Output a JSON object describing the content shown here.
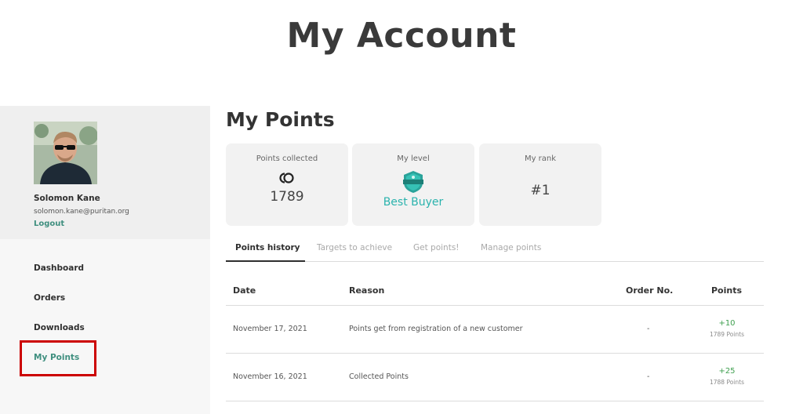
{
  "page": {
    "title": "My Account"
  },
  "profile": {
    "name": "Solomon Kane",
    "email": "solomon.kane@puritan.org",
    "logout_label": "Logout"
  },
  "nav": {
    "items": [
      {
        "label": "Dashboard"
      },
      {
        "label": "Orders"
      },
      {
        "label": "Downloads"
      },
      {
        "label": "My Points",
        "active": true
      }
    ]
  },
  "main": {
    "title": "My Points",
    "cards": {
      "points_collected": {
        "label": "Points collected",
        "value": "1789",
        "icon": "points-coin-icon"
      },
      "my_level": {
        "label": "My level",
        "value": "Best Buyer",
        "badge_icon": "best-buyer-badge-icon"
      },
      "my_rank": {
        "label": "My rank",
        "value": "#1"
      }
    },
    "tabs": [
      {
        "label": "Points history",
        "active": true
      },
      {
        "label": "Targets to achieve"
      },
      {
        "label": "Get points!"
      },
      {
        "label": "Manage points"
      }
    ],
    "table": {
      "headers": {
        "date": "Date",
        "reason": "Reason",
        "order_no": "Order No.",
        "points": "Points"
      },
      "rows": [
        {
          "date": "November 17, 2021",
          "reason": "Points get from registration of a new customer",
          "order_no": "-",
          "points": "+10",
          "points_total": "1789 Points"
        },
        {
          "date": "November 16, 2021",
          "reason": "Collected Points",
          "order_no": "-",
          "points": "+25",
          "points_total": "1788 Points"
        }
      ]
    }
  },
  "colors": {
    "accent": "#3f8f7f",
    "level": "#2bb3ad",
    "positive": "#3f9f4f",
    "highlight": "#cc0000"
  }
}
